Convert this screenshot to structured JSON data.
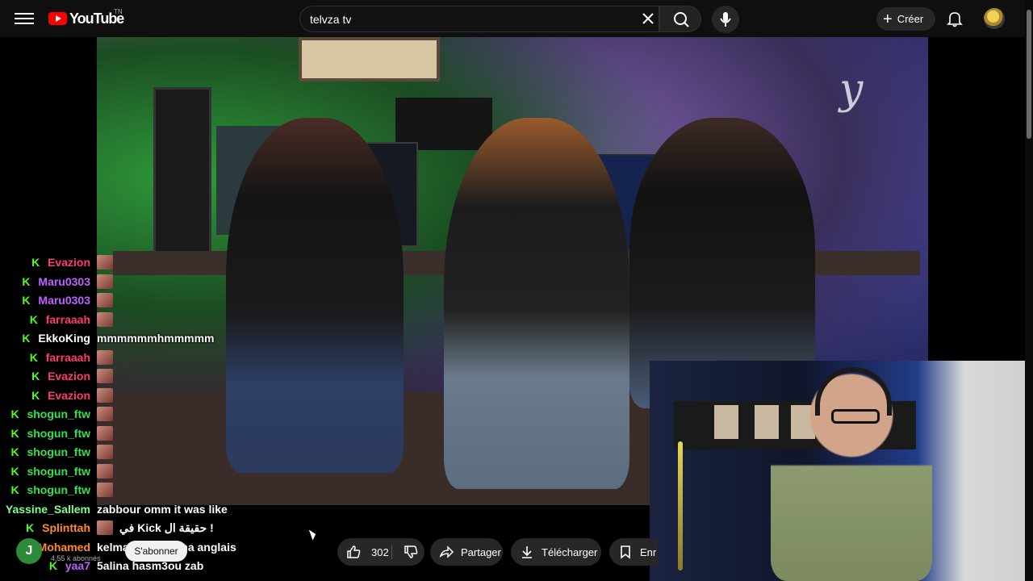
{
  "header": {
    "logo_text": "YouTube",
    "logo_country": "TN",
    "search_value": "telvza tv",
    "create_label": "Créer"
  },
  "video": {
    "watermark": "y"
  },
  "chat": [
    {
      "user": "Evazion",
      "color": "#ff3b6b",
      "emote": true,
      "text": ""
    },
    {
      "user": "Maru0303",
      "color": "#c060ff",
      "emote": true,
      "text": ""
    },
    {
      "user": "Maru0303",
      "color": "#c060ff",
      "emote": true,
      "text": ""
    },
    {
      "user": "farraaah",
      "color": "#ff3b6b",
      "emote": true,
      "text": ""
    },
    {
      "user": "EkkoKing",
      "color": "#ffffff",
      "emote": false,
      "text": "mmmmmmhmmmmm"
    },
    {
      "user": "farraaah",
      "color": "#ff3b6b",
      "emote": true,
      "text": ""
    },
    {
      "user": "Evazion",
      "color": "#ff3b6b",
      "emote": true,
      "text": ""
    },
    {
      "user": "Evazion",
      "color": "#ff3b6b",
      "emote": true,
      "text": ""
    },
    {
      "user": "shogun_ftw",
      "color": "#34e34c",
      "emote": true,
      "text": ""
    },
    {
      "user": "shogun_ftw",
      "color": "#34e34c",
      "emote": true,
      "text": ""
    },
    {
      "user": "shogun_ftw",
      "color": "#34e34c",
      "emote": true,
      "text": ""
    },
    {
      "user": "shogun_ftw",
      "color": "#34e34c",
      "emote": true,
      "text": ""
    },
    {
      "user": "shogun_ftw",
      "color": "#34e34c",
      "emote": true,
      "text": ""
    },
    {
      "user": "Yassine_Sallem",
      "color": "#7fff8a",
      "emote": false,
      "text": "zabbour omm it was like"
    },
    {
      "user": "Splinttah",
      "color": "#ff8c2a",
      "emote": true,
      "text": "في Kick حقيقة ال !"
    },
    {
      "user": "Mohamed",
      "color": "#ff8c2a",
      "emote": false,
      "text": "kelma derja kelma anglais"
    },
    {
      "user": "yaa7",
      "color": "#c060ff",
      "emote": false,
      "text": "5alina hasm3ou zab"
    }
  ],
  "channel": {
    "avatar_letter": "J",
    "subscribers": "4,55 k abonnés",
    "subscribe_label": "S'abonner"
  },
  "actions": {
    "like_count": "302",
    "share_label": "Partager",
    "download_label": "Télécharger",
    "save_label": "Enr"
  },
  "colors": {
    "kick_green": "#53fc18",
    "brand_red": "#ff0000"
  }
}
